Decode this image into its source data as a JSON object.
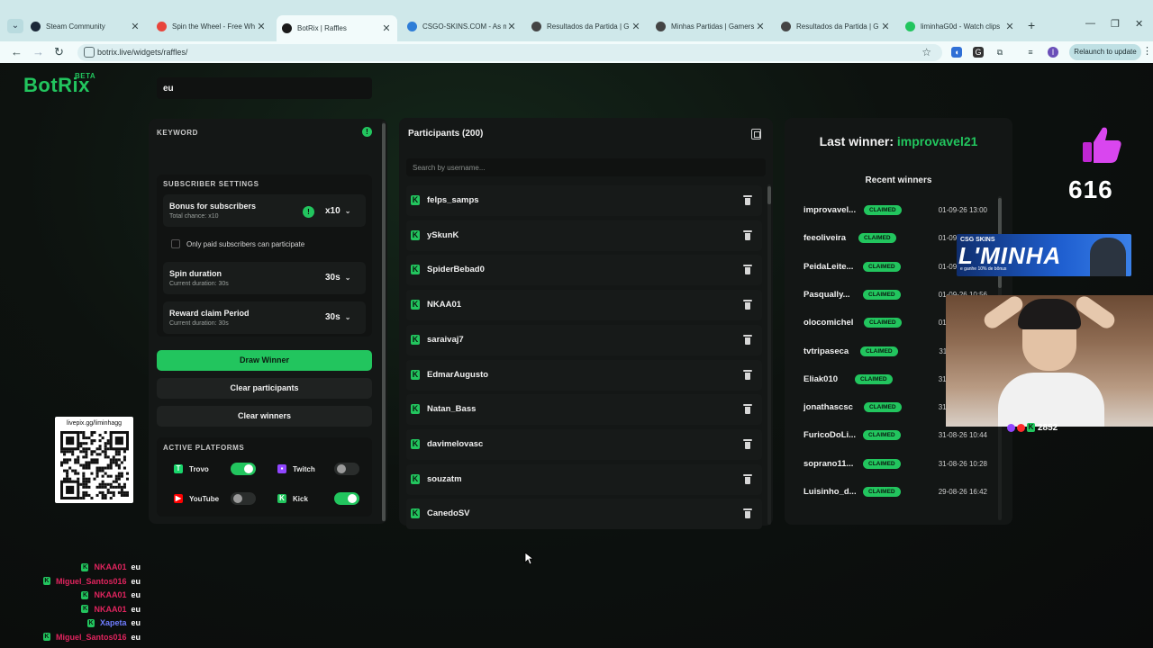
{
  "browser": {
    "tabs": [
      {
        "label": "Steam Community",
        "color": "#1b2838"
      },
      {
        "label": "Spin the Wheel - Free Wh",
        "color": "#e8453c"
      },
      {
        "label": "BotRix | Raffles",
        "color": "#1a1a1a",
        "active": true
      },
      {
        "label": "CSGO-SKINS.COM - As m",
        "color": "#2e7dd7"
      },
      {
        "label": "Resultados da Partida | G",
        "color": "#444444"
      },
      {
        "label": "Minhas Partidas | Gamers",
        "color": "#444444"
      },
      {
        "label": "Resultados da Partida | G",
        "color": "#444444"
      },
      {
        "label": "liminhaG0d - Watch clips",
        "color": "#22c55e"
      }
    ],
    "url": "botrix.live/widgets/raffles/",
    "relaunch_label": "Relaunch to update",
    "profile_initial": "I"
  },
  "app": {
    "logo": "BotRix",
    "logo_badge": "BETA",
    "accent": "#22c55e"
  },
  "settings": {
    "keyword_label": "KEYWORD",
    "keyword_value": "eu",
    "subscriber_settings_label": "SUBSCRIBER SETTINGS",
    "bonus": {
      "title": "Bonus for subscribers",
      "sub": "Total chance: x10",
      "value": "x10"
    },
    "paid_only_label": "Only paid subscribers can participate",
    "spin": {
      "title": "Spin duration",
      "sub": "Current duration: 30s",
      "value": "30s"
    },
    "reward": {
      "title": "Reward claim Period",
      "sub": "Current duration: 30s",
      "value": "30s"
    },
    "draw_label": "Draw Winner",
    "clear_participants_label": "Clear participants",
    "clear_winners_label": "Clear winners",
    "platforms_label": "ACTIVE PLATFORMS",
    "platforms": [
      {
        "name": "Trovo",
        "on": true,
        "color": "#19d66b"
      },
      {
        "name": "Twitch",
        "on": false,
        "color": "#9146ff"
      },
      {
        "name": "YouTube",
        "on": false,
        "color": "#ff0000"
      },
      {
        "name": "Kick",
        "on": true,
        "color": "#22c55e"
      }
    ]
  },
  "participants": {
    "title": "Participants (200)",
    "search_placeholder": "Search by username...",
    "list": [
      "felps_samps",
      "ySkunK",
      "SpiderBebad0",
      "NKAA01",
      "saraivaj7",
      "EdmarAugusto",
      "Natan_Bass",
      "davimelovasc",
      "souzatm",
      "CanedoSV"
    ]
  },
  "winners": {
    "last_winner_prefix": "Last winner: ",
    "last_winner_name": "improvavel21",
    "recent_title": "Recent winners",
    "claimed_label": "CLAIMED",
    "list": [
      {
        "user": "improvavel...",
        "date": "01-09-26 13:00"
      },
      {
        "user": "feeoliveira",
        "date": "01-09-26 12:57"
      },
      {
        "user": "PeidaLeite...",
        "date": "01-09-26 12:48"
      },
      {
        "user": "Pasqually...",
        "date": "01-09-26 10:56"
      },
      {
        "user": "olocomichel",
        "date": "01-09-26 10:52"
      },
      {
        "user": "tvtripaseca",
        "date": "31-08-26 11:00"
      },
      {
        "user": "Eliak010",
        "date": "31-08-26 10:58"
      },
      {
        "user": "jonathascsc",
        "date": "31-08-26 10:50"
      },
      {
        "user": "FuricoDoLi...",
        "date": "31-08-26 10:44"
      },
      {
        "user": "soprano11...",
        "date": "31-08-26 10:28"
      },
      {
        "user": "Luisinho_d...",
        "date": "29-08-26 16:42"
      }
    ]
  },
  "overlay": {
    "qr_url": "livepix.gg/liminhagg",
    "like_count": "616",
    "banner_brand": "CSG SKINS",
    "banner_main": "L'MINHA",
    "banner_promo": "e ganhe 10% de bônus",
    "viewer_count": "2852"
  },
  "chat": [
    {
      "user": "NKAA01",
      "msg": "eu",
      "color": "#e0245e"
    },
    {
      "user": "Miguel_Santos016",
      "msg": "eu",
      "color": "#e0245e"
    },
    {
      "user": "NKAA01",
      "msg": "eu",
      "color": "#e0245e"
    },
    {
      "user": "NKAA01",
      "msg": "eu",
      "color": "#e0245e"
    },
    {
      "user": "Xapeta",
      "msg": "eu",
      "color": "#6f7dff"
    },
    {
      "user": "Miguel_Santos016",
      "msg": "eu",
      "color": "#e0245e"
    }
  ]
}
